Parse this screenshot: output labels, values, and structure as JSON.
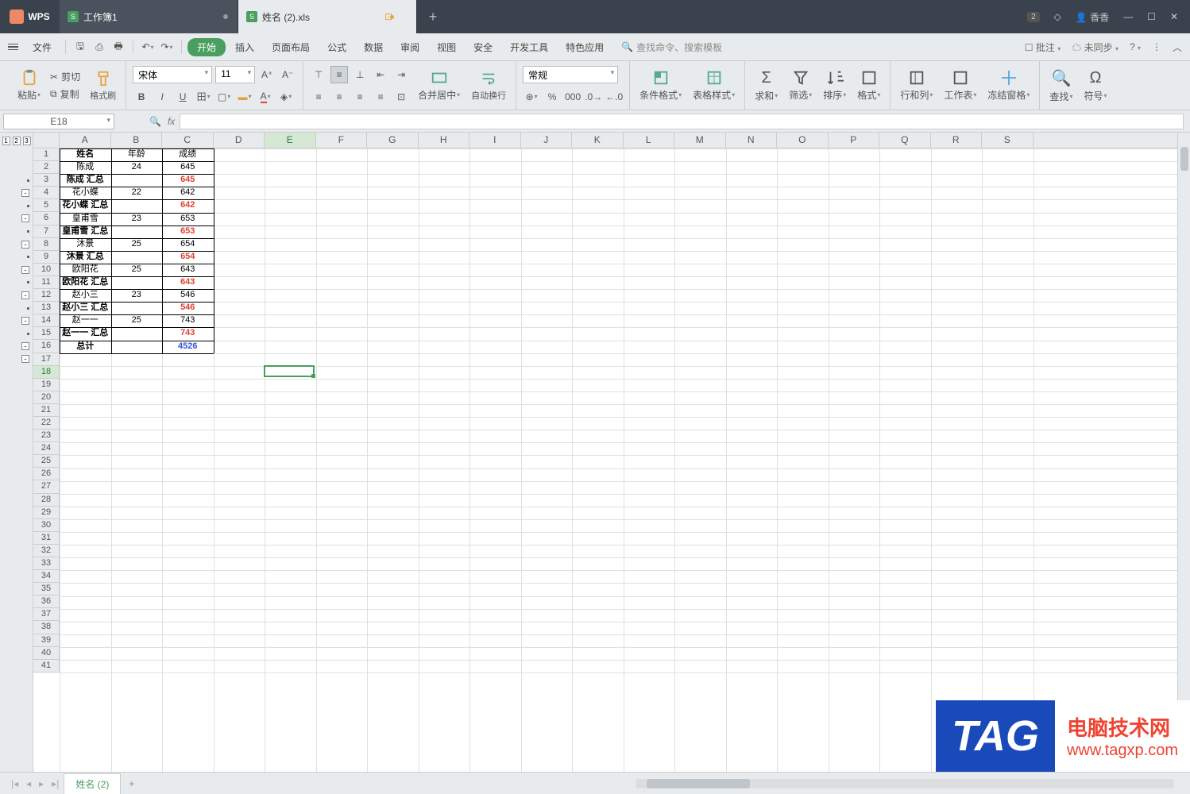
{
  "app": {
    "name": "WPS"
  },
  "tabs": [
    {
      "label": "工作簿1"
    },
    {
      "label": "姓名 (2).xls"
    }
  ],
  "user": {
    "name": "香香",
    "badge": "2"
  },
  "menu": {
    "file": "文件",
    "items": [
      "开始",
      "插入",
      "页面布局",
      "公式",
      "数据",
      "审阅",
      "视图",
      "安全",
      "开发工具",
      "特色应用"
    ],
    "search_placeholder": "查找命令、搜索模板",
    "annotate": "批注",
    "sync": "未同步"
  },
  "ribbon": {
    "paste": "粘贴",
    "cut": "剪切",
    "copy": "复制",
    "format_painter": "格式刷",
    "font_name": "宋体",
    "font_size": "11",
    "merge": "合并居中",
    "wrap": "自动换行",
    "number_format": "常规",
    "cond": "条件格式",
    "tblstyle": "表格样式",
    "sum": "求和",
    "filter": "筛选",
    "sort": "排序",
    "fmt": "格式",
    "rowcol": "行和列",
    "sheet": "工作表",
    "freeze": "冻结窗格",
    "find": "查找",
    "symbol": "符号"
  },
  "namebox": "E18",
  "columns": [
    "A",
    "B",
    "C",
    "D",
    "E",
    "F",
    "G",
    "H",
    "I",
    "J",
    "K",
    "L",
    "M",
    "N",
    "O",
    "P",
    "Q",
    "R",
    "S"
  ],
  "row_count": 41,
  "selected": {
    "col": 4,
    "row": 17
  },
  "data_rows": [
    {
      "a": "姓名",
      "b": "年龄",
      "c": "成绩",
      "hd": true
    },
    {
      "a": "陈成",
      "b": "24",
      "c": "645"
    },
    {
      "a": "陈成 汇总",
      "c": "645",
      "sub": true
    },
    {
      "a": "花小蝶",
      "b": "22",
      "c": "642"
    },
    {
      "a": "花小蝶 汇总",
      "c": "642",
      "sub": true
    },
    {
      "a": "皇甫雪",
      "b": "23",
      "c": "653"
    },
    {
      "a": "皇甫雪 汇总",
      "c": "653",
      "sub": true
    },
    {
      "a": "沐景",
      "b": "25",
      "c": "654"
    },
    {
      "a": "沐景 汇总",
      "c": "654",
      "sub": true
    },
    {
      "a": "欧阳花",
      "b": "25",
      "c": "643"
    },
    {
      "a": "欧阳花 汇总",
      "c": "643",
      "sub": true
    },
    {
      "a": "赵小三",
      "b": "23",
      "c": "546"
    },
    {
      "a": "赵小三 汇总",
      "c": "546",
      "sub": true
    },
    {
      "a": "赵一一",
      "b": "25",
      "c": "743"
    },
    {
      "a": "赵一一 汇总",
      "c": "743",
      "sub": true
    },
    {
      "a": "总计",
      "c": "4526",
      "tot": true
    }
  ],
  "sheet_tab": "姓名 (2)",
  "watermark": {
    "tag": "TAG",
    "cn": "电脑技术网",
    "url": "www.tagxp.com"
  }
}
